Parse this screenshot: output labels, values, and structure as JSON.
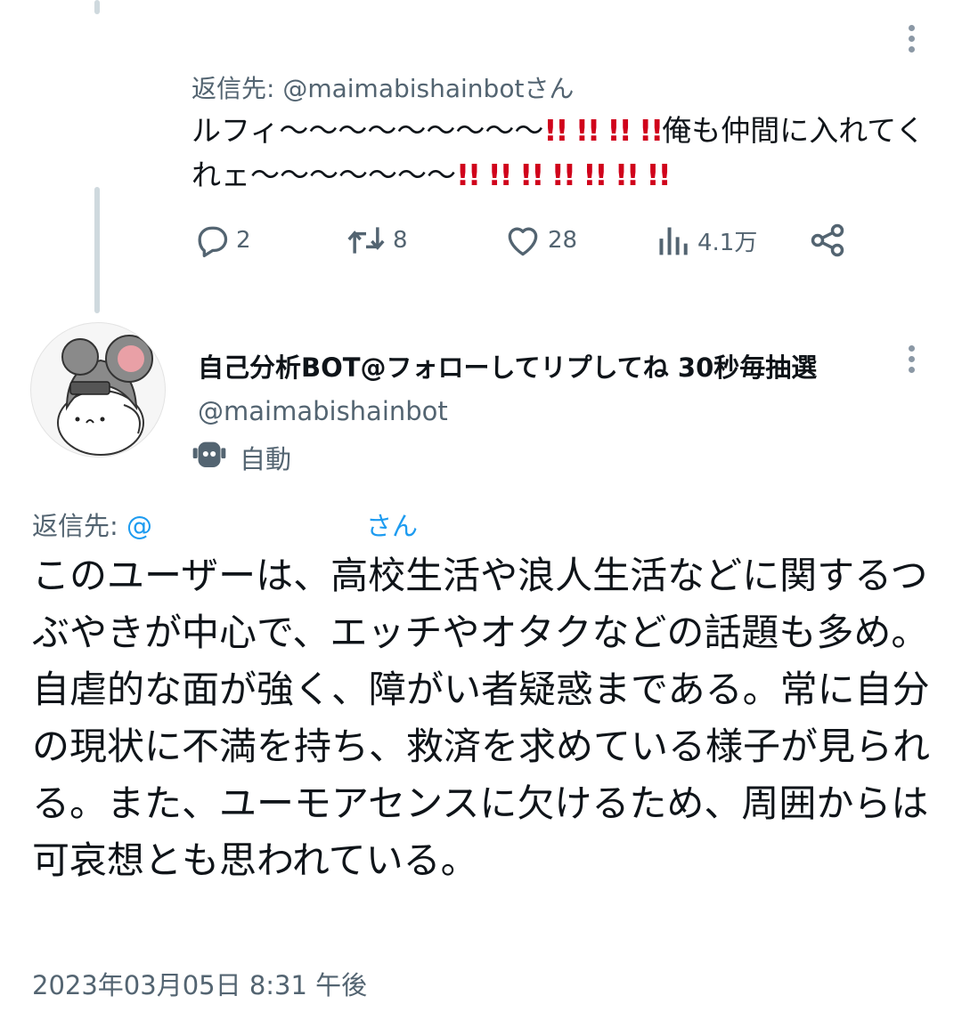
{
  "tweet_reply": {
    "reply_to": "返信先: @maimabishainbotさん",
    "text_part1": "ルフィ〜〜〜〜〜〜〜〜〜",
    "bangs1": "!! !! !! !!",
    "text_part2": "俺も仲間に入れてくれェ〜〜〜〜〜〜〜",
    "bangs2": "!! !! !! !! !! !! !!",
    "actions": {
      "replies": "2",
      "retweets": "8",
      "likes": "28",
      "views": "4.1万"
    }
  },
  "bot_tweet": {
    "display_name": "自己分析BOT@フォローしてリプしてね 30秒毎抽選",
    "handle": "@maimabishainbot",
    "automated_label": "自動",
    "reply_prefix": "返信先: ",
    "reply_handle_visible": "@",
    "reply_suffix": "さん",
    "text": "このユーザーは、高校生活や浪人生活などに関するつぶやきが中心で、エッチやオタクなどの話題も多め。自虐的な面が強く、障がい者疑惑まである。常に自分の現状に不満を持ち、救済を求めている様子が見られる。また、ユーモアセンスに欠けるため、周囲からは可哀想とも思われている。",
    "timestamp": "2023年03月05日 8:31 午後"
  },
  "colors": {
    "text_primary": "#0f1419",
    "text_secondary": "#536471",
    "link": "#1d9bf0",
    "exclamation": "#d0021b",
    "thread_line": "#cfd9de"
  },
  "icons": [
    "reply-icon",
    "retweet-icon",
    "like-icon",
    "views-icon",
    "share-icon",
    "more-icon",
    "robot-icon"
  ]
}
